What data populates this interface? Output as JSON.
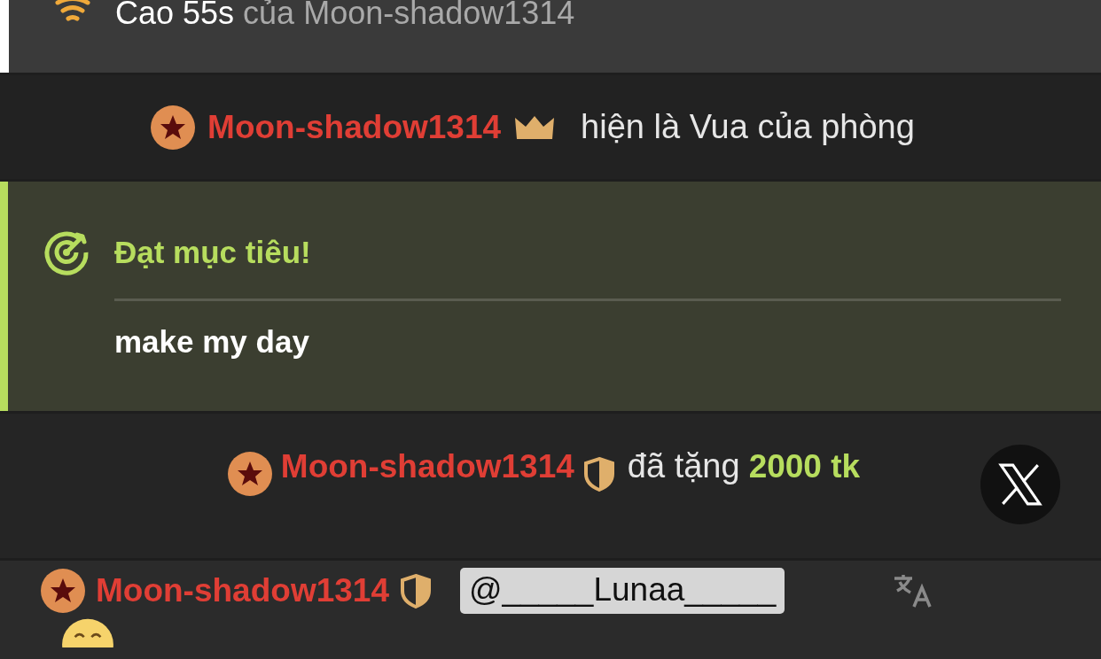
{
  "top_message": {
    "lead": "Cao 55s",
    "rest": "của Moon-shadow1314"
  },
  "king_notice": {
    "user": "Moon-shadow1314",
    "text": "hiện là Vua của phòng"
  },
  "goal": {
    "title": "Đạt mục tiêu!",
    "text": "make my day"
  },
  "gift": {
    "user": "Moon-shadow1314",
    "verb": "đã tặng",
    "amount": "2000 tk"
  },
  "chat": {
    "user": "Moon-shadow1314",
    "mention": "@_____Lunaa_____"
  }
}
